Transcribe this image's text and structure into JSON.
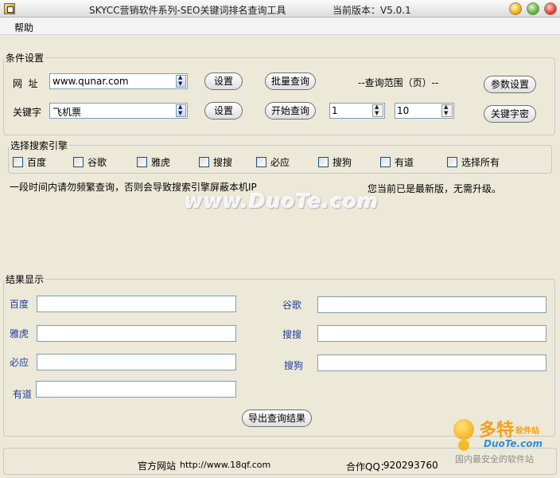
{
  "window": {
    "title": "SKYCC营销软件系列-SEO关键词排名查询工具",
    "version_label": "当前版本：V5.0.1"
  },
  "menu": {
    "help": "帮助"
  },
  "conditions": {
    "legend": "条件设置",
    "url_label": "网  址",
    "url_value": "www.qunar.com",
    "keyword_label": "关键字",
    "keyword_value": "飞机票",
    "set_button": "设置",
    "batch_query_button": "批量查询",
    "start_query_button": "开始查询",
    "range_label": "--查询范围（页）--",
    "range_from": "1",
    "range_to": "10",
    "params_button": "参数设置",
    "keyword_density_button": "关键字密"
  },
  "engines": {
    "legend": "选择搜索引擎",
    "options": [
      "百度",
      "谷歌",
      "雅虎",
      "搜搜",
      "必应",
      "搜狗",
      "有道",
      "选择所有"
    ]
  },
  "notices": {
    "warning": "一段时间内请勿频繁查询，否则会导致搜索引擎屏蔽本机IP",
    "update_status": "您当前已是最新版，无需升级。"
  },
  "watermark": "www.DuoTe.com",
  "results": {
    "legend": "结果显示",
    "baidu": "百度",
    "google": "谷歌",
    "yahoo": "雅虎",
    "soso": "搜搜",
    "bing": "必应",
    "sogou": "搜狗",
    "youdao": "有道",
    "export_button": "导出查询结果"
  },
  "footer": {
    "site_label": "官方网站",
    "site_url": "http://www.18qf.com",
    "qq_label": "合作QQ：",
    "qq_value": "920293760"
  },
  "logo": {
    "big_text": "多特",
    "small_text": "软件站",
    "site": "DuoTe.com",
    "slogan": "国内最安全的软件站"
  },
  "colors": {
    "accent_blue": "#1c3e96",
    "logo_orange": "#f59f1a",
    "logo_blue": "#2d8fd8"
  }
}
